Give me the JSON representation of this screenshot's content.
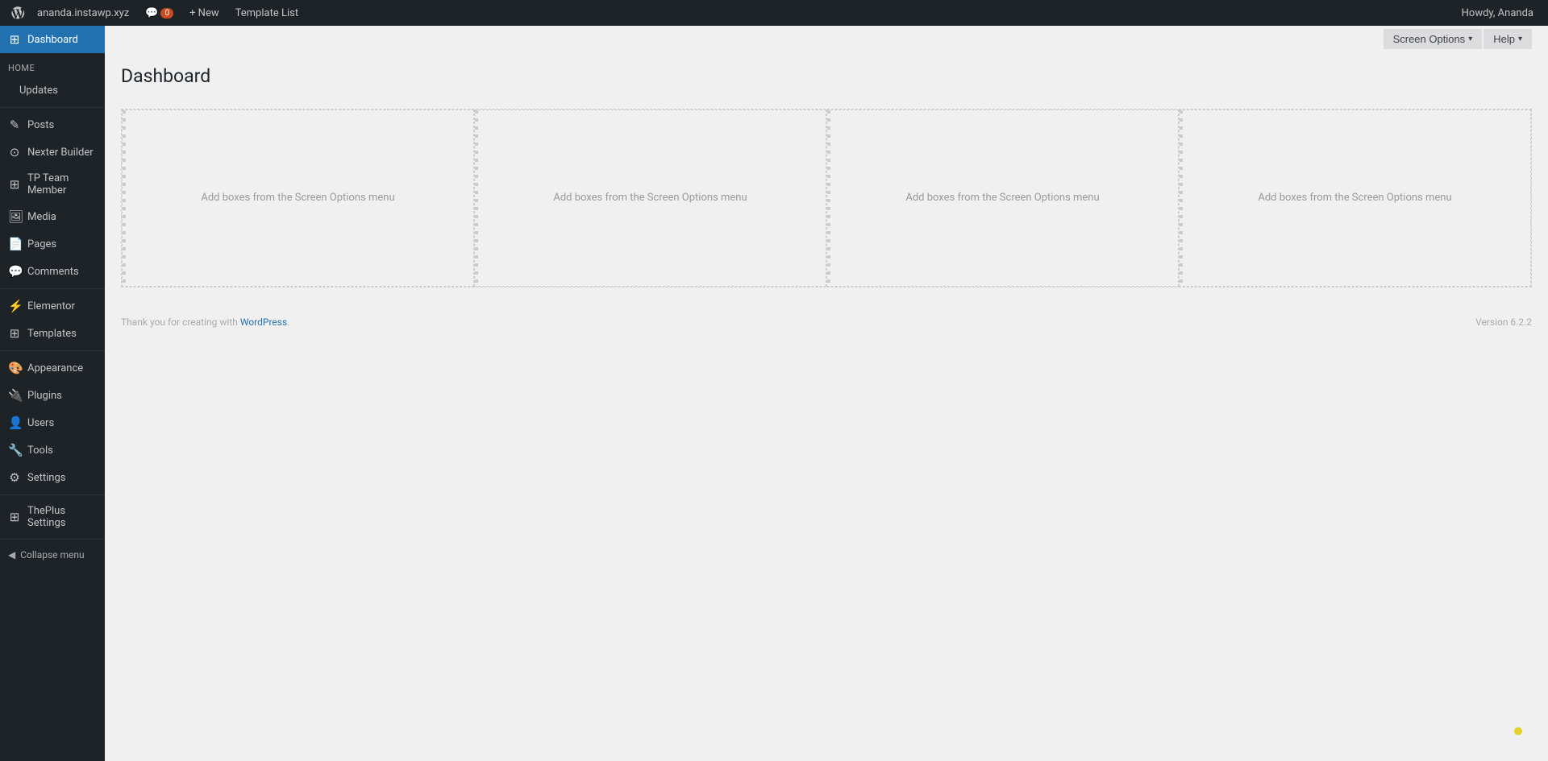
{
  "adminbar": {
    "logo_symbol": "W",
    "site_name": "ananda.instawp.xyz",
    "comments_count": "0",
    "new_label": "+ New",
    "template_list_label": "Template List",
    "howdy_label": "Howdy, Ananda"
  },
  "sidebar": {
    "active_item": "Dashboard",
    "home_section": "Home",
    "items": [
      {
        "id": "dashboard",
        "label": "Dashboard",
        "icon": "⊞",
        "active": true
      },
      {
        "id": "updates",
        "label": "Updates",
        "icon": "",
        "sub": true
      },
      {
        "id": "posts",
        "label": "Posts",
        "icon": "✎"
      },
      {
        "id": "nexter-builder",
        "label": "Nexter Builder",
        "icon": "⊙"
      },
      {
        "id": "tp-team-member",
        "label": "TP Team Member",
        "icon": "⊞"
      },
      {
        "id": "media",
        "label": "Media",
        "icon": "🖼"
      },
      {
        "id": "pages",
        "label": "Pages",
        "icon": "📄"
      },
      {
        "id": "comments",
        "label": "Comments",
        "icon": "💬"
      },
      {
        "id": "elementor",
        "label": "Elementor",
        "icon": "⚡"
      },
      {
        "id": "templates",
        "label": "Templates",
        "icon": "⊞"
      },
      {
        "id": "appearance",
        "label": "Appearance",
        "icon": "🎨"
      },
      {
        "id": "plugins",
        "label": "Plugins",
        "icon": "🔌"
      },
      {
        "id": "users",
        "label": "Users",
        "icon": "👤"
      },
      {
        "id": "tools",
        "label": "Tools",
        "icon": "🔧"
      },
      {
        "id": "settings",
        "label": "Settings",
        "icon": "⚙"
      },
      {
        "id": "theplus-settings",
        "label": "ThePlus Settings",
        "icon": "⊞"
      }
    ],
    "collapse_label": "Collapse menu"
  },
  "screen_meta": {
    "screen_options_label": "Screen Options",
    "screen_options_arrow": "▾",
    "help_label": "Help",
    "help_arrow": "▾"
  },
  "main": {
    "title": "Dashboard",
    "columns": [
      {
        "placeholder": "Add boxes from the Screen Options menu"
      },
      {
        "placeholder": "Add boxes from the Screen Options menu"
      },
      {
        "placeholder": "Add boxes from the Screen Options menu"
      },
      {
        "placeholder": "Add boxes from the Screen Options menu"
      }
    ]
  },
  "footer": {
    "thank_you_text": "Thank you for creating with",
    "wordpress_link_text": "WordPress",
    "version_text": "Version 6.2.2"
  }
}
